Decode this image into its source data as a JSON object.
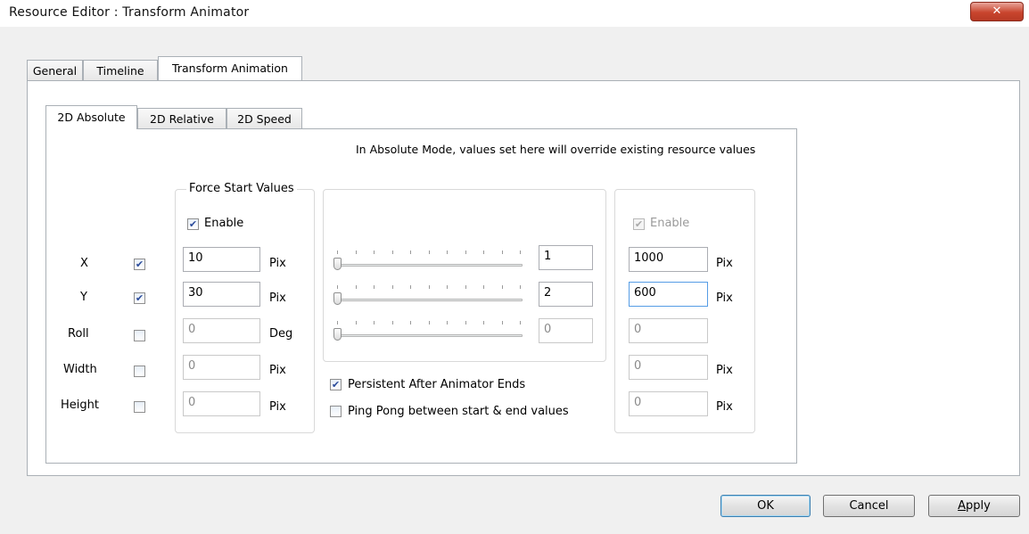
{
  "window": {
    "title": "Resource Editor  :  Transform Animator",
    "close_icon": "x-close-icon"
  },
  "tabs": [
    {
      "label": "General"
    },
    {
      "label": "Timeline"
    },
    {
      "label": "Transform Animation",
      "active": true
    }
  ],
  "subtabs": [
    {
      "label": "2D Absolute",
      "active": true
    },
    {
      "label": "2D Relative"
    },
    {
      "label": "2D Speed"
    }
  ],
  "info_text": "In Absolute Mode, values set here will override existing resource values",
  "rows": [
    {
      "label": "X",
      "checked": true,
      "start": "10",
      "start_unit": "Pix",
      "slider": "1",
      "end": "1000",
      "end_unit": "Pix"
    },
    {
      "label": "Y",
      "checked": true,
      "start": "30",
      "start_unit": "Pix",
      "slider": "2",
      "end": "600",
      "end_unit": "Pix"
    },
    {
      "label": "Roll",
      "checked": false,
      "start": "0",
      "start_unit": "Deg",
      "slider": "0",
      "end": "0",
      "end_unit": ""
    },
    {
      "label": "Width",
      "checked": false,
      "start": "0",
      "start_unit": "Pix",
      "end": "0",
      "end_unit": "Pix"
    },
    {
      "label": "Height",
      "checked": false,
      "start": "0",
      "start_unit": "Pix",
      "end": "0",
      "end_unit": "Pix"
    }
  ],
  "force_start": {
    "caption": "Force Start Values",
    "enable_label": "Enable",
    "enabled": true
  },
  "end_group": {
    "enable_label": "Enable",
    "enabled": true,
    "disabled": true
  },
  "options": {
    "persistent_label": "Persistent After Animator Ends",
    "persistent": true,
    "pingpong_label": "Ping Pong between start & end values",
    "pingpong": false
  },
  "buttons": {
    "ok": "OK",
    "cancel": "Cancel",
    "apply_first": "A",
    "apply_rest": "pply"
  },
  "colors": {
    "accent": "#3c7fb1",
    "close": "#c9452e",
    "check": "#2a4b9b"
  }
}
